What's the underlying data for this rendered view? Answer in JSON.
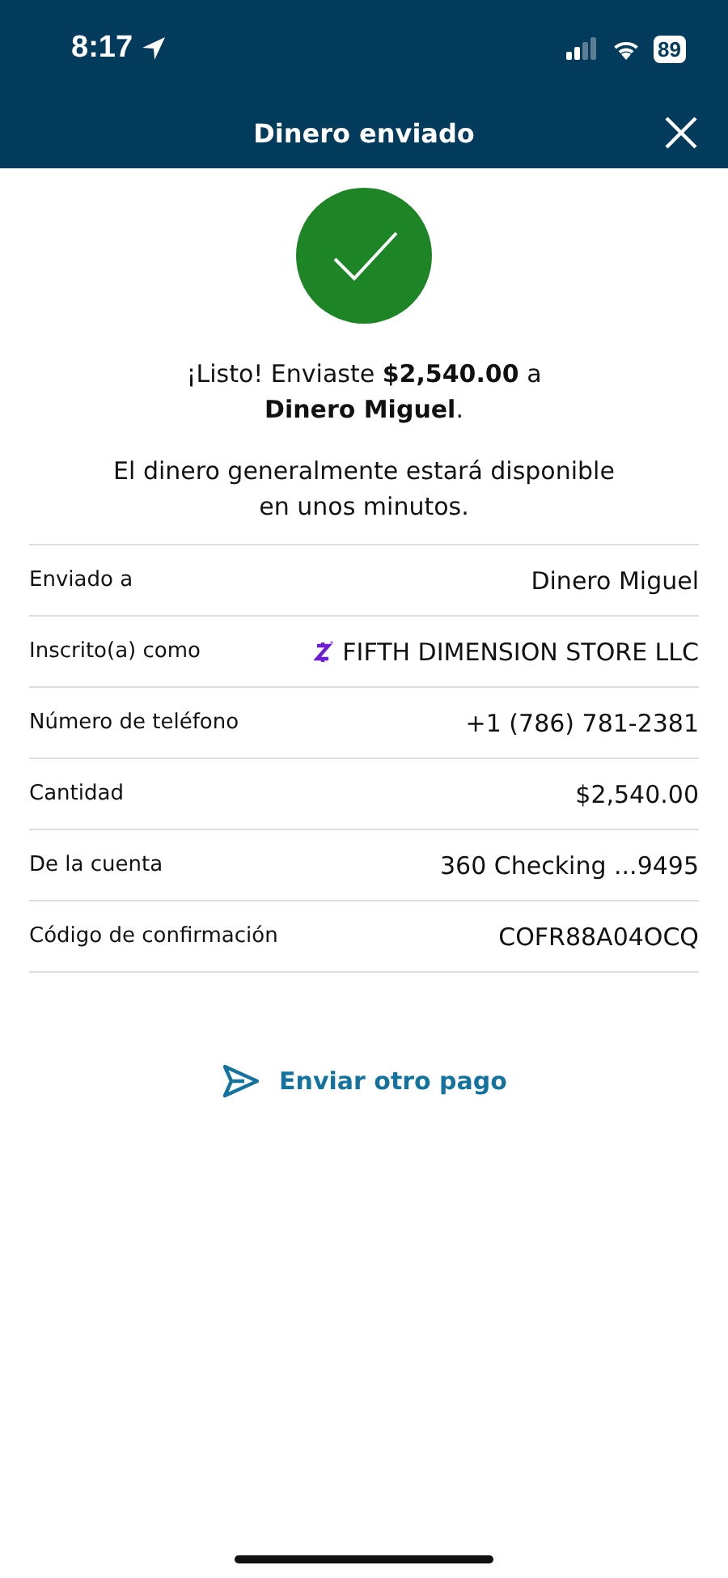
{
  "status_bar": {
    "time": "8:17",
    "battery": "89"
  },
  "header": {
    "title": "Dinero enviado"
  },
  "message": "¡Listo! Enviaste **$2,540.00** a **Dinero Miguel**.",
  "note": "El dinero generalmente estará disponible en unos minutos.",
  "details": [
    {
      "kind": "text",
      "label": "Enviado a",
      "value": "Dinero Miguel"
    },
    {
      "kind": "enrolled",
      "label": "Inscrito(a) como",
      "value": "FIFTH DIMENSION STORE LLC"
    },
    {
      "kind": "text",
      "label": "Número de teléfono",
      "value": "+1 (786) 781-2381"
    },
    {
      "kind": "text",
      "label": "Cantidad",
      "value": "$2,540.00"
    },
    {
      "kind": "text",
      "label": "De la cuenta",
      "value": "360 Checking ...9495"
    },
    {
      "kind": "text",
      "label": "Código de confirmación",
      "value": "COFR88A04OCQ"
    }
  ],
  "action": {
    "label": "Enviar otro pago"
  }
}
